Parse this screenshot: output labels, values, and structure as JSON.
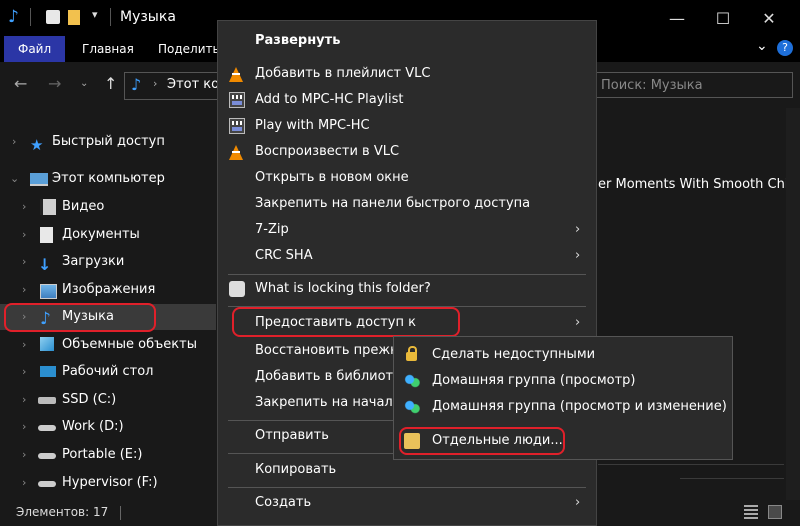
{
  "window": {
    "title": "Музыка",
    "controls": {
      "minimize": "—",
      "maximize": "☐",
      "close": "✕"
    }
  },
  "ribbon": {
    "tabs": [
      "Файл",
      "Главная",
      "Поделить"
    ],
    "collapse_icon": "⌄",
    "help_icon": "?"
  },
  "address": {
    "path_fragment": "Этот ко",
    "search_placeholder": "Поиск: Музыка"
  },
  "nav": {
    "items": [
      {
        "label": "Быстрый доступ",
        "icon": "star-icon"
      },
      {
        "label": "Этот компьютер",
        "icon": "computer-icon"
      },
      {
        "label": "Видео",
        "icon": "video-folder-icon"
      },
      {
        "label": "Документы",
        "icon": "documents-folder-icon"
      },
      {
        "label": "Загрузки",
        "icon": "downloads-folder-icon"
      },
      {
        "label": "Изображения",
        "icon": "pictures-folder-icon"
      },
      {
        "label": "Музыка",
        "icon": "music-folder-icon"
      },
      {
        "label": "Объемные объекты",
        "icon": "3d-objects-icon"
      },
      {
        "label": "Рабочий стол",
        "icon": "desktop-icon"
      },
      {
        "label": "SSD (C:)",
        "icon": "drive-icon"
      },
      {
        "label": "Work (D:)",
        "icon": "drive-icon"
      },
      {
        "label": "Portable (E:)",
        "icon": "drive-icon"
      },
      {
        "label": "Hypervisor (F:)",
        "icon": "drive-icon"
      }
    ]
  },
  "content": {
    "visible_text": "er Moments With Smooth Chill"
  },
  "status": {
    "items_count": "Элементов: 17"
  },
  "context_menu": {
    "items": [
      {
        "label": "Развернуть",
        "bold": true
      },
      {
        "label": "Добавить в плейлист VLC",
        "icon": "vlc-icon"
      },
      {
        "label": "Add to MPC-HC Playlist",
        "icon": "mpc-hc-icon"
      },
      {
        "label": "Play with MPC-HC",
        "icon": "mpc-hc-icon"
      },
      {
        "label": "Воспроизвести в VLC",
        "icon": "vlc-icon"
      },
      {
        "label": "Открыть в новом окне"
      },
      {
        "label": "Закрепить на панели быстрого доступа"
      },
      {
        "label": "7-Zip",
        "submenu": true
      },
      {
        "label": "CRC SHA",
        "submenu": true
      },
      {
        "label": "What is locking this folder?",
        "icon": "lock-search-icon"
      },
      {
        "label": "Предоставить доступ к",
        "submenu": true
      },
      {
        "label": "Восстановить прежн"
      },
      {
        "label": "Добавить в библиоте"
      },
      {
        "label": "Закрепить на началь"
      },
      {
        "label": "Отправить"
      },
      {
        "label": "Копировать"
      },
      {
        "label": "Создать",
        "submenu": true
      }
    ],
    "submenu_arrow": "›"
  },
  "share_submenu": {
    "items": [
      {
        "label": "Сделать недоступными",
        "icon": "lock-icon"
      },
      {
        "label": "Домашняя группа (просмотр)",
        "icon": "homegroup-icon"
      },
      {
        "label": "Домашняя группа (просмотр и изменение)",
        "icon": "homegroup-icon"
      },
      {
        "label": "Отдельные люди...",
        "icon": "people-icon"
      }
    ]
  }
}
